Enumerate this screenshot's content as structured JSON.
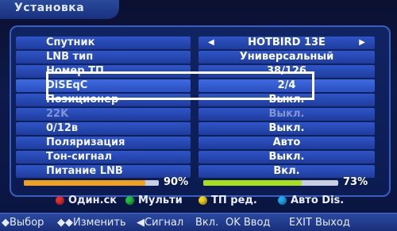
{
  "window": {
    "title": "Установка"
  },
  "menu": {
    "rows": [
      {
        "label": "Спутник",
        "value": "HOTBIRD 13E",
        "has_arrows": true
      },
      {
        "label": "LNB тип",
        "value": "Универсальный"
      },
      {
        "label": "Номер ТП",
        "value": "38/126"
      },
      {
        "label": "DiSEqC",
        "value": "2/4",
        "selected": true
      },
      {
        "label": "Позиционер",
        "value": "Выкл."
      },
      {
        "label": "22K",
        "value": "Выкл.",
        "disabled": true
      },
      {
        "label": "0/12в",
        "value": "Выкл."
      },
      {
        "label": "Поляризация",
        "value": "Авто"
      },
      {
        "label": "Тон-сигнал",
        "value": "Выкл."
      },
      {
        "label": "Питание LNB",
        "value": "Вкл."
      }
    ],
    "arrow_left_icon": "◀",
    "arrow_right_icon": "▶"
  },
  "signal": {
    "strength_percent_text": "90%",
    "strength_value": 0.9,
    "quality_percent_text": "73%",
    "quality_value": 0.73,
    "strength_color": "#f0a020",
    "quality_color": "#a8e020"
  },
  "keys": [
    {
      "color": "#e53030",
      "label": "Один.ск"
    },
    {
      "color": "#20c040",
      "label": "Мульти"
    },
    {
      "color": "#f0d020",
      "label": "ТП ред."
    },
    {
      "color": "#20a8f0",
      "label": "Авто Dis."
    }
  ],
  "hints": {
    "select": "◆Выбор",
    "change": "◆◆Изменить",
    "signal": "◀Сигнал",
    "on": "Вкл.",
    "ok": "OK Ввод",
    "exit": "EXIT Выход"
  }
}
